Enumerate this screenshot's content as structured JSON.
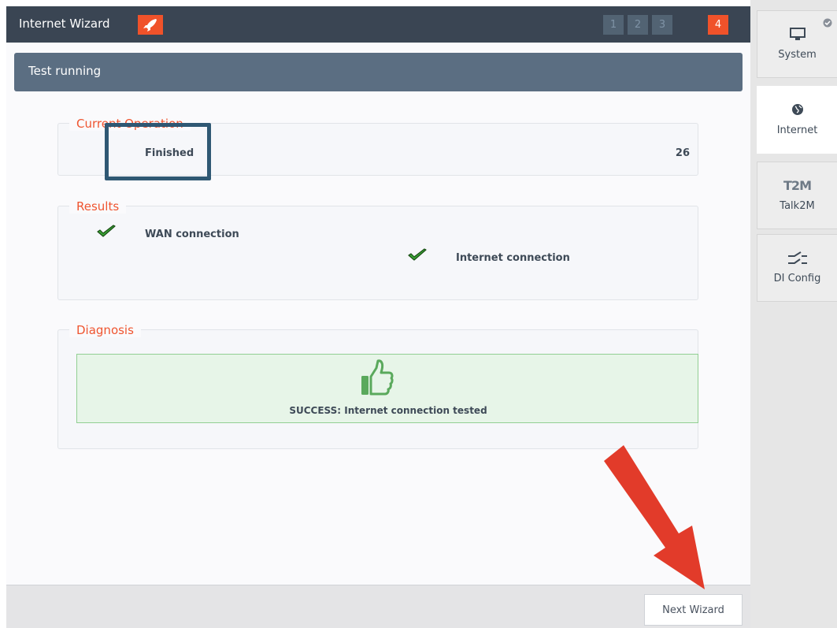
{
  "header": {
    "title": "Internet Wizard",
    "steps": [
      "1",
      "2",
      "3",
      "4"
    ],
    "active_step": "4"
  },
  "subheader": {
    "title": "Test running"
  },
  "current_operation": {
    "legend": "Current Operation",
    "status": "Finished",
    "count": "26"
  },
  "results": {
    "legend": "Results",
    "items": [
      {
        "label": "WAN connection",
        "icon": "check-icon"
      },
      {
        "label": "Internet connection",
        "icon": "check-icon"
      }
    ]
  },
  "diagnosis": {
    "legend": "Diagnosis",
    "icon": "thumbs-up-icon",
    "message": "SUCCESS: Internet connection tested"
  },
  "footer": {
    "next_label": "Next Wizard"
  },
  "sidebar": {
    "items": [
      {
        "label": "System",
        "icon": "monitor-icon"
      },
      {
        "label": "Internet",
        "icon": "globe-icon"
      },
      {
        "label": "Talk2M",
        "icon": "t2m-logo-icon",
        "icon_text": "T2M"
      },
      {
        "label": "DI Config",
        "icon": "switch-icon"
      }
    ],
    "active": "Internet"
  },
  "colors": {
    "accent": "#f0522a",
    "header_bg": "#3a4553",
    "subheader_bg": "#5b6e82",
    "success_bg": "#e7f5e8",
    "success_border": "#92cf93",
    "highlight_box": "#2f5873",
    "arrow": "#e23b2a"
  }
}
